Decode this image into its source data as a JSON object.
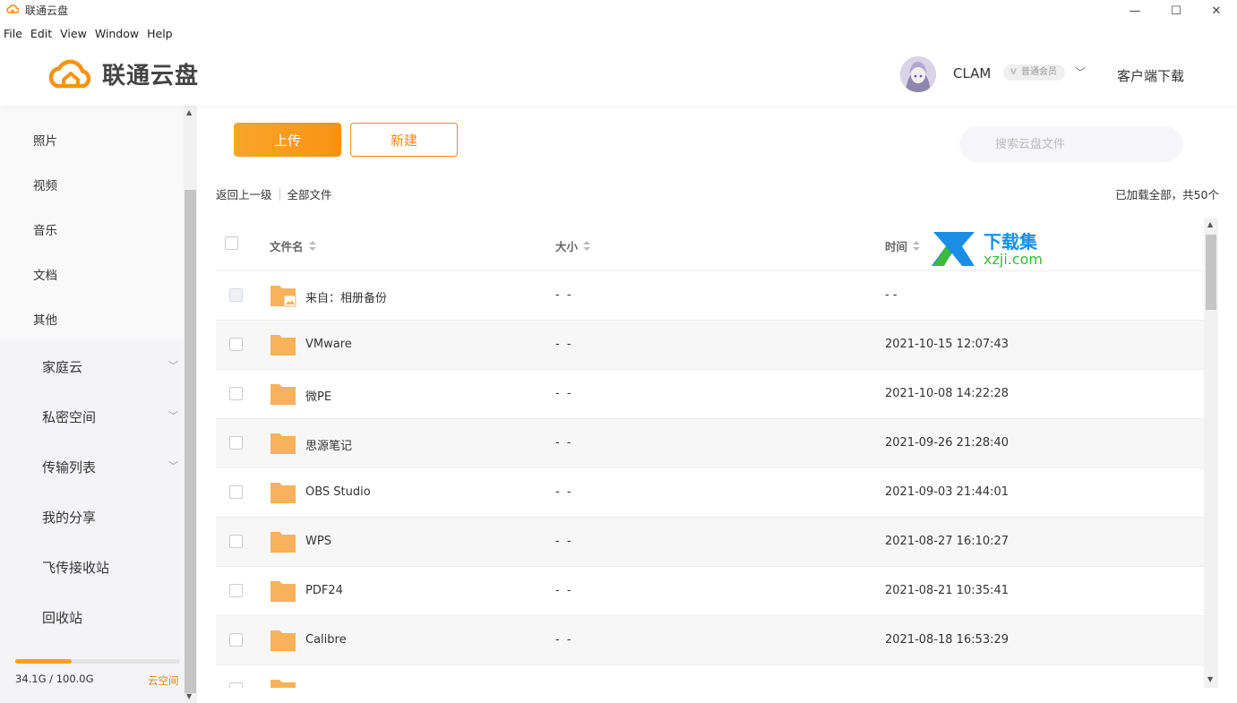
{
  "window": {
    "title": "联通云盘",
    "min_glyph": "—",
    "max_glyph": "☐",
    "close_glyph": "✕"
  },
  "menu": [
    "File",
    "Edit",
    "View",
    "Window",
    "Help"
  ],
  "header": {
    "logo_text": "联通云盘",
    "username": "CLAM",
    "member_badge": "普通会员",
    "chevron": "﹀",
    "client_download": "客户端下载"
  },
  "sidebar": {
    "categories": [
      "照片",
      "视频",
      "音乐",
      "文档",
      "其他"
    ],
    "groups": [
      {
        "label": "家庭云",
        "has_chevron": true
      },
      {
        "label": "私密空间",
        "has_chevron": true
      },
      {
        "label": "传输列表",
        "has_chevron": true
      },
      {
        "label": "我的分享",
        "has_chevron": false
      },
      {
        "label": "飞传接收站",
        "has_chevron": false
      },
      {
        "label": "回收站",
        "has_chevron": false
      }
    ],
    "storage": {
      "used_text": "34.1G / 100.0G",
      "used_fraction": 0.341,
      "link": "云空间"
    }
  },
  "toolbar": {
    "upload_label": "上传",
    "new_label": "新建",
    "search_placeholder": "搜索云盘文件"
  },
  "breadcrumb": {
    "back": "返回上一级",
    "current": "全部文件",
    "loaded_info": "已加载全部，共50个"
  },
  "table": {
    "columns": {
      "name": "文件名",
      "size": "大小",
      "time": "时间"
    },
    "rows": [
      {
        "name": "来自：相册备份",
        "size": "- -",
        "time": "- -",
        "special": true
      },
      {
        "name": "VMware",
        "size": "- -",
        "time": "2021-10-15 12:07:43"
      },
      {
        "name": "微PE",
        "size": "- -",
        "time": "2021-10-08 14:22:28"
      },
      {
        "name": "思源笔记",
        "size": "- -",
        "time": "2021-09-26 21:28:40"
      },
      {
        "name": "OBS Studio",
        "size": "- -",
        "time": "2021-09-03 21:44:01"
      },
      {
        "name": "WPS",
        "size": "- -",
        "time": "2021-08-27 16:10:27"
      },
      {
        "name": "PDF24",
        "size": "- -",
        "time": "2021-08-21 10:35:41"
      },
      {
        "name": "Calibre",
        "size": "- -",
        "time": "2021-08-18 16:53:29"
      }
    ]
  },
  "watermark": {
    "cn": "下载集",
    "en": "xzji.com"
  },
  "colors": {
    "accent": "#f79312",
    "folder": "#f7b25a",
    "watermark_blue": "#1a8ee6",
    "watermark_green": "#3cba3c"
  }
}
